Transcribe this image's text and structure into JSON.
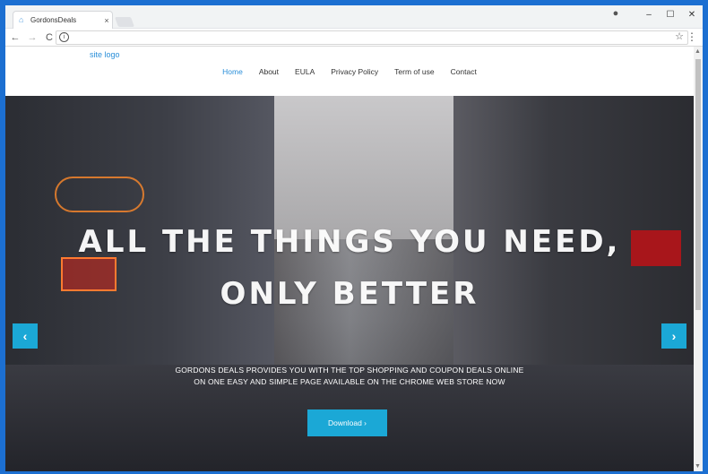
{
  "browser": {
    "tab_title": "GordonsDeals",
    "tab_close": "×",
    "window_controls": {
      "minimize": "–",
      "maximize": "☐",
      "close": "✕"
    },
    "nav": {
      "back": "←",
      "forward": "→",
      "reload": "C"
    },
    "address": "",
    "icons": [
      "home-icon",
      "user-icon",
      "info-icon",
      "star-icon",
      "menu-icon"
    ]
  },
  "site": {
    "logo": "site logo",
    "nav": [
      {
        "label": "Home",
        "active": true
      },
      {
        "label": "About"
      },
      {
        "label": "EULA"
      },
      {
        "label": "Privacy Policy"
      },
      {
        "label": "Term of use"
      },
      {
        "label": "Contact"
      }
    ]
  },
  "hero": {
    "title_line1": "ALL THE THINGS YOU NEED,",
    "title_line2": "ONLY BETTER",
    "subtitle_line1": "GORDONS DEALS PROVIDES YOU WITH THE TOP SHOPPING AND COUPON DEALS ONLINE",
    "subtitle_line2": "ON ONE EASY AND SIMPLE PAGE AVAILABLE ON THE CHROME WEB STORE NOW",
    "download_label": "Download ›",
    "prev_label": "‹",
    "next_label": "›"
  },
  "colors": {
    "accent": "#1ba8d6",
    "link": "#2a8fd9",
    "frame": "#1c6fd1"
  }
}
